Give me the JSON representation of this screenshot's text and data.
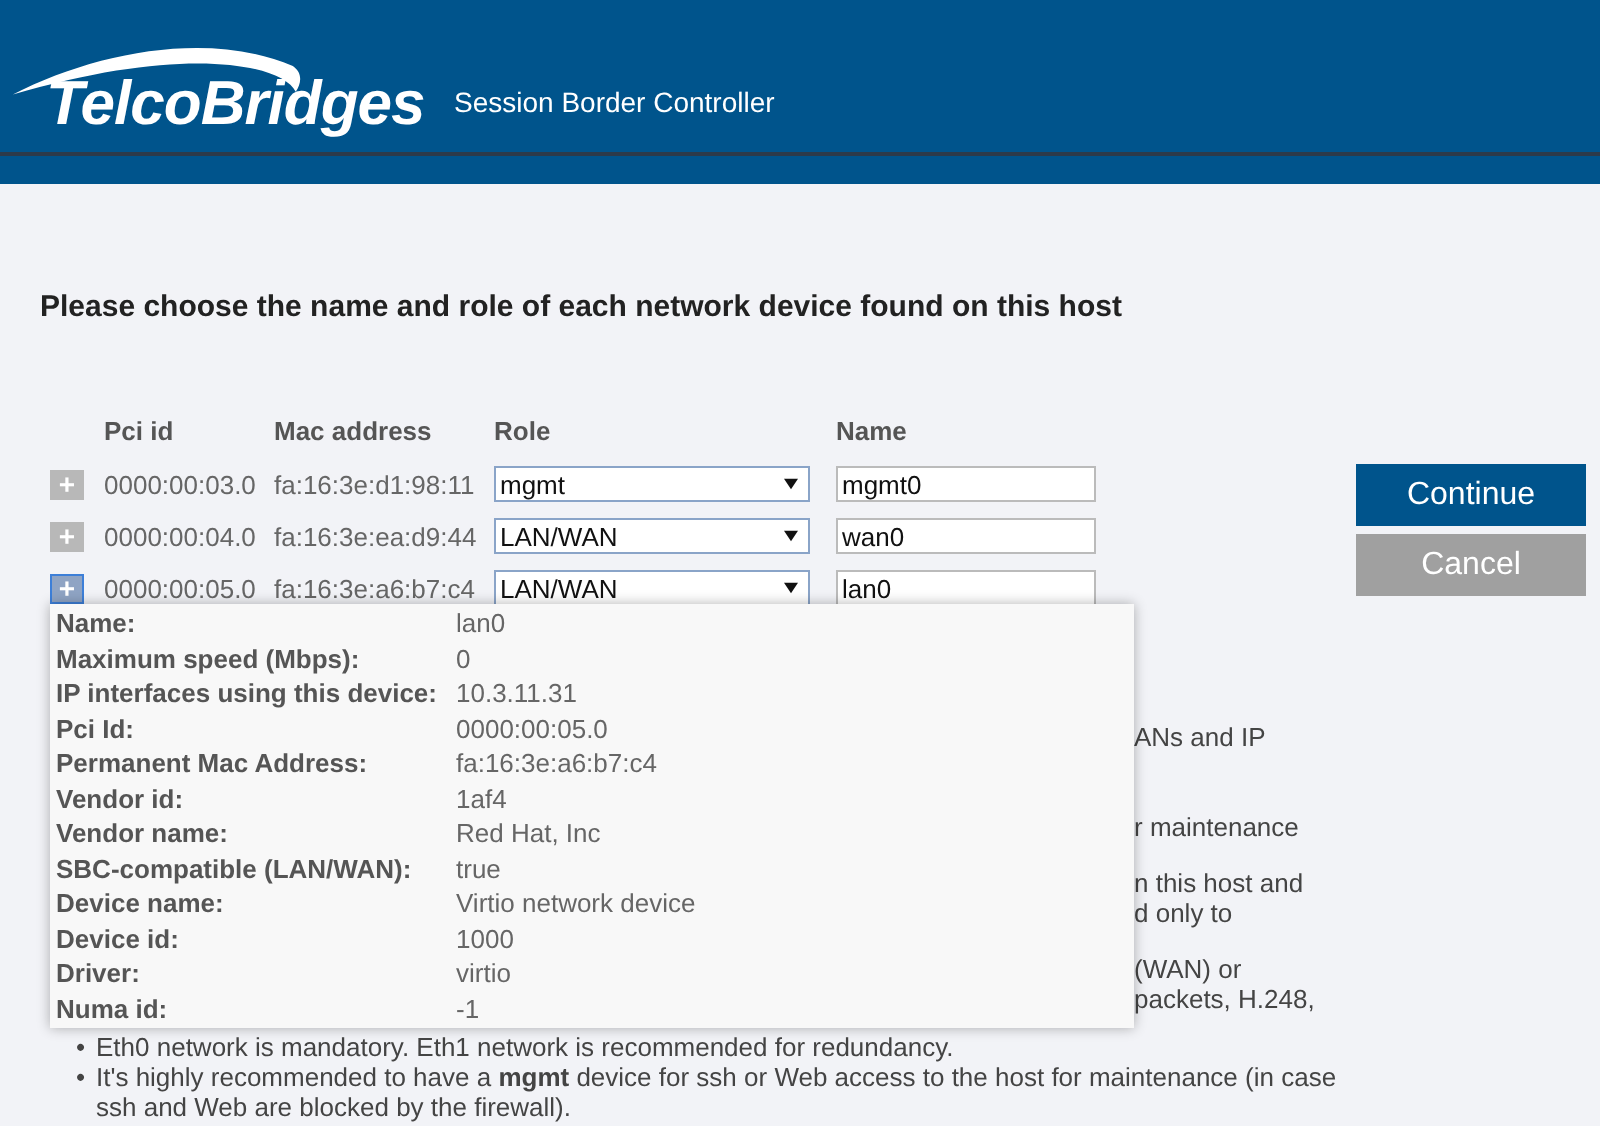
{
  "header": {
    "logo": "TelcoBridges",
    "subtitle": "Session Border Controller"
  },
  "heading": "Please choose the name and role of each network device found on this host",
  "table": {
    "columns": [
      "Pci id",
      "Mac address",
      "Role",
      "Name"
    ],
    "rows": [
      {
        "expand": "+",
        "hovered": false,
        "pci": "0000:00:03.0",
        "mac": "fa:16:3e:d1:98:11",
        "role": "mgmt",
        "name": "mgmt0"
      },
      {
        "expand": "+",
        "hovered": false,
        "pci": "0000:00:04.0",
        "mac": "fa:16:3e:ea:d9:44",
        "role": "LAN/WAN",
        "name": "wan0"
      },
      {
        "expand": "+",
        "hovered": true,
        "pci": "0000:00:05.0",
        "mac": "fa:16:3e:a6:b7:c4",
        "role": "LAN/WAN",
        "name": "lan0"
      }
    ]
  },
  "buttons": [
    {
      "label": "Continue",
      "kind": "primary"
    },
    {
      "label": "Cancel",
      "kind": "secondary"
    }
  ],
  "notes": {
    "fragments": [
      [
        "ANs and IP"
      ],
      [
        "r maintenance"
      ],
      [
        "n this host and",
        "d only to"
      ],
      [
        "(WAN) or",
        "packets, H.248,"
      ]
    ],
    "bullets": [
      {
        "marker": "•",
        "text": "Eth0 network is mandatory. Eth1 network is recommended for redundancy."
      },
      {
        "marker": "•",
        "text": "It's highly recommended to have a **mgmt** device for ssh or Web access to the host for maintenance (in case ssh and Web are blocked by the firewall)."
      }
    ]
  },
  "tooltip": [
    {
      "label": "Name:",
      "value": "lan0"
    },
    {
      "label": "Maximum speed (Mbps):",
      "value": "0"
    },
    {
      "label": "IP interfaces using this device:",
      "value": "10.3.11.31"
    },
    {
      "label": "Pci Id:",
      "value": "0000:00:05.0"
    },
    {
      "label": "Permanent Mac Address:",
      "value": "fa:16:3e:a6:b7:c4"
    },
    {
      "label": "Vendor id:",
      "value": "1af4"
    },
    {
      "label": "Vendor name:",
      "value": "Red Hat, Inc"
    },
    {
      "label": "SBC-compatible (LAN/WAN):",
      "value": "true"
    },
    {
      "label": "Device name:",
      "value": "Virtio network device"
    },
    {
      "label": "Device id:",
      "value": "1000"
    },
    {
      "label": "Driver:",
      "value": "virtio"
    },
    {
      "label": "Numa id:",
      "value": "-1"
    }
  ]
}
